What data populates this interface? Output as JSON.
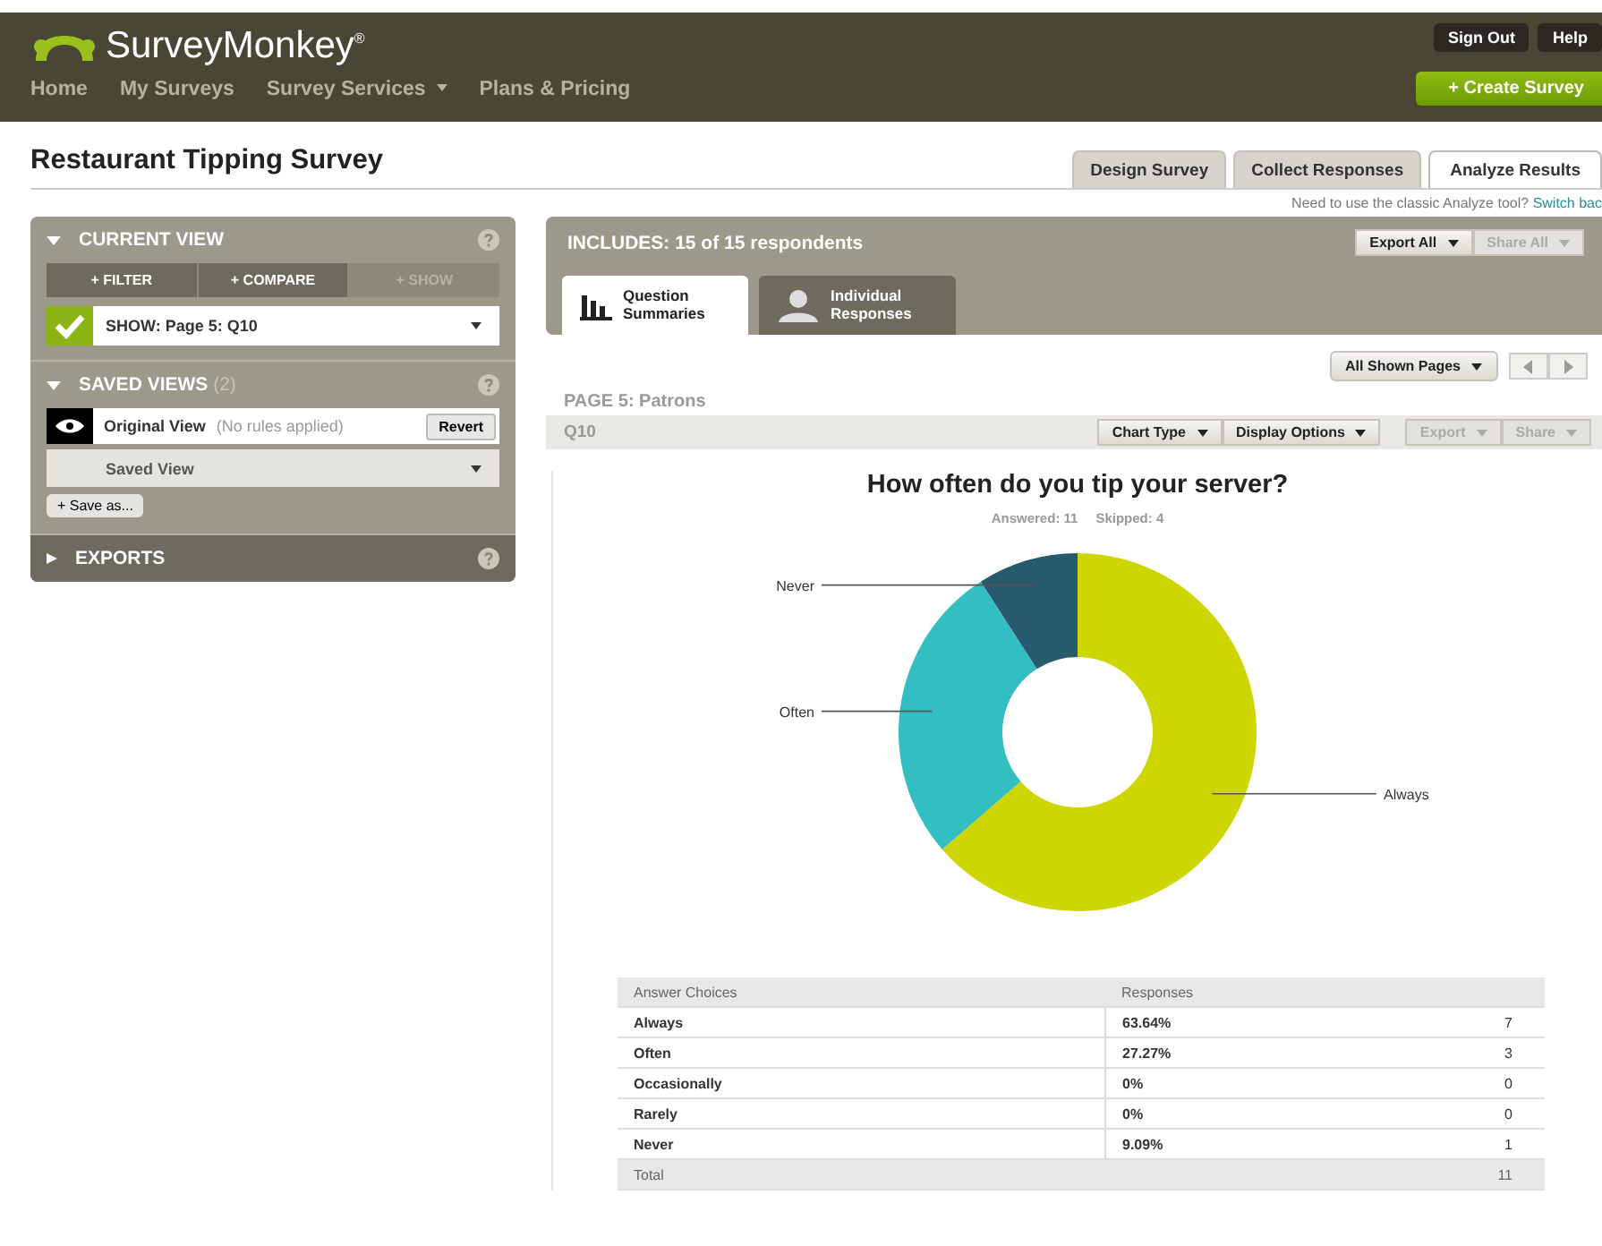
{
  "header": {
    "logo": "SurveyMonkey",
    "logo_mark": "®",
    "nav": [
      {
        "label": "Home",
        "dropdown": false
      },
      {
        "label": "My Surveys",
        "dropdown": false
      },
      {
        "label": "Survey Services",
        "dropdown": true
      },
      {
        "label": "Plans & Pricing",
        "dropdown": false
      }
    ],
    "account_buttons": [
      "Sign Out",
      "Help"
    ],
    "create_button": "+ Create Survey"
  },
  "survey": {
    "title": "Restaurant Tipping Survey",
    "tabs": [
      {
        "label": "Design Survey",
        "selected": false
      },
      {
        "label": "Collect Responses",
        "selected": false
      },
      {
        "label": "Analyze Results",
        "selected": true
      }
    ],
    "classic_note": "Need to use the classic Analyze tool?",
    "classic_link": "Switch bac"
  },
  "sidebar": {
    "current_view": {
      "title": "CURRENT VIEW",
      "expanded": true,
      "actions": [
        {
          "label": "+ FILTER",
          "disabled": false
        },
        {
          "label": "+ COMPARE",
          "disabled": false
        },
        {
          "label": "+ SHOW",
          "disabled": true
        }
      ],
      "show_rule": "SHOW: Page 5: Q10"
    },
    "saved_views": {
      "title": "SAVED VIEWS",
      "count": "(2)",
      "expanded": true,
      "original": {
        "name": "Original View",
        "note": "(No rules applied)",
        "button": "Revert"
      },
      "saved": "Saved View",
      "save_as": "+ Save as..."
    },
    "exports": {
      "title": "EXPORTS",
      "expanded": false
    }
  },
  "results": {
    "includes": "INCLUDES: 15 of 15 respondents",
    "top_buttons": [
      {
        "label": "Export All",
        "disabled": false
      },
      {
        "label": "Share All",
        "disabled": true
      }
    ],
    "view_tabs": [
      {
        "label": "Question Summaries",
        "kind": "chart",
        "selected": true
      },
      {
        "label": "Individual Responses",
        "kind": "person",
        "selected": false
      }
    ],
    "pages_button": "All Shown Pages",
    "page_title": "PAGE 5: Patrons",
    "question": {
      "number": "Q10",
      "buttons": [
        {
          "label": "Chart Type",
          "disabled": false
        },
        {
          "label": "Display Options",
          "disabled": false
        },
        {
          "label": "Export",
          "disabled": true
        },
        {
          "label": "Share",
          "disabled": true
        }
      ],
      "title": "How often do you tip your server?",
      "answered": "Answered: 11",
      "skipped": "Skipped: 4",
      "chart_data": {
        "type": "donut",
        "categories": [
          "Always",
          "Often",
          "Never"
        ],
        "series": [
          {
            "values": [
              63.64,
              27.27,
              9.09
            ]
          }
        ],
        "colors": [
          "#cdd600",
          "#33bfc1",
          "#275a6c"
        ]
      },
      "table": {
        "columns": [
          "Answer Choices",
          "Responses"
        ],
        "rows": [
          {
            "choice": "Always",
            "percent": "63.64%",
            "count": "7"
          },
          {
            "choice": "Often",
            "percent": "27.27%",
            "count": "3"
          },
          {
            "choice": "Occasionally",
            "percent": "0%",
            "count": "0"
          },
          {
            "choice": "Rarely",
            "percent": "0%",
            "count": "0"
          },
          {
            "choice": "Never",
            "percent": "9.09%",
            "count": "1"
          }
        ],
        "total_label": "Total",
        "total": "11"
      }
    }
  }
}
